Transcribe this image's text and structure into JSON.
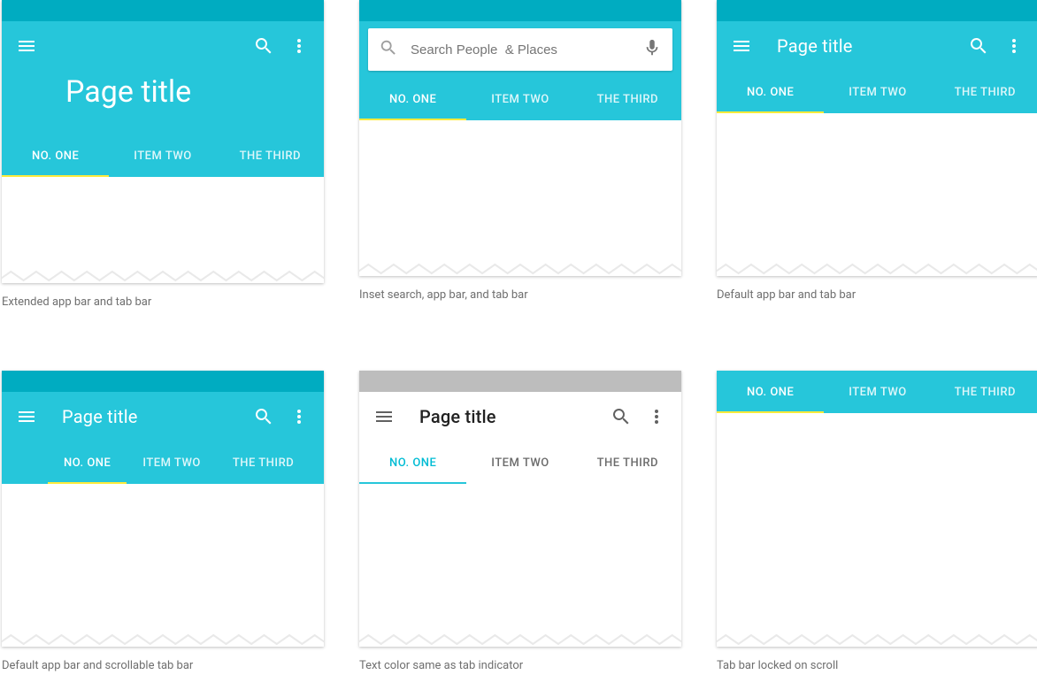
{
  "colors": {
    "primary": "#26C6DA",
    "primary_dark": "#00ACC1",
    "accent_indicator": "#FFEB3B",
    "teal_indicator": "#26C6DA"
  },
  "common": {
    "page_title": "Page title",
    "tabs": [
      "NO. ONE",
      "ITEM TWO",
      "THE THIRD"
    ]
  },
  "panels": [
    {
      "id": "p1",
      "caption": "Extended app bar and tab bar"
    },
    {
      "id": "p2",
      "caption": "Inset search, app bar, and tab bar",
      "search_placeholder": "Search People  & Places"
    },
    {
      "id": "p3",
      "caption": "Default app bar and tab bar"
    },
    {
      "id": "p4",
      "caption": "Default app bar and scrollable tab bar"
    },
    {
      "id": "p5",
      "caption": "Text color same as tab indicator"
    },
    {
      "id": "p6",
      "caption": "Tab bar locked on scroll"
    }
  ]
}
